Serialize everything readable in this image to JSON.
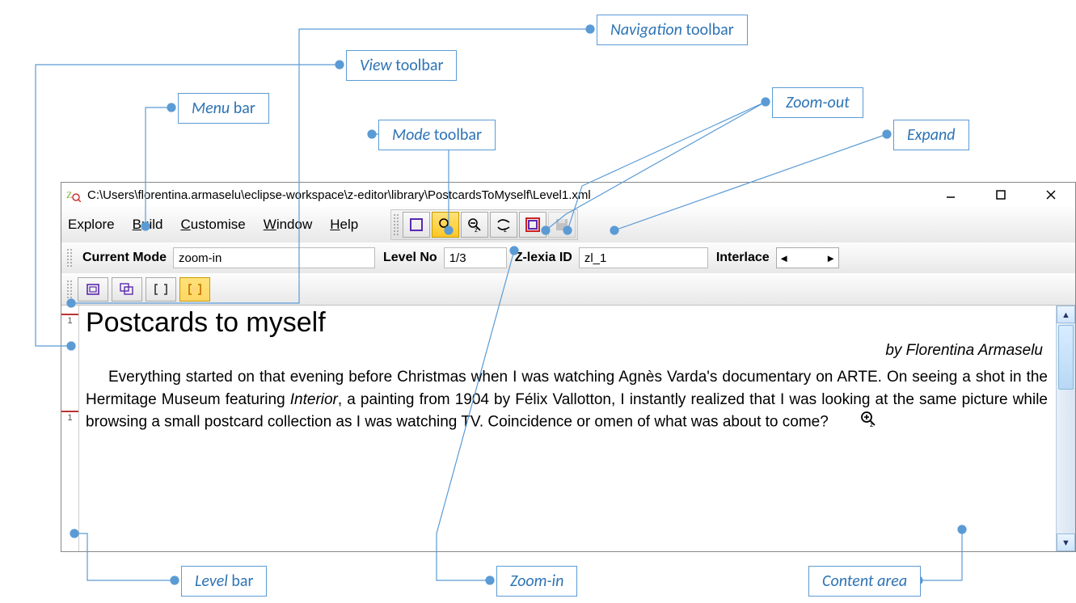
{
  "callouts": {
    "navigation_toolbar": "Navigation ",
    "navigation_toolbar_suffix": "toolbar",
    "view_toolbar": "View ",
    "view_toolbar_suffix": "toolbar",
    "menu_bar": "Menu ",
    "menu_bar_suffix": "bar",
    "mode_toolbar": "Mode ",
    "mode_toolbar_suffix": "toolbar",
    "zoom_out": "Zoom-out",
    "expand": "Expand",
    "zoom_in": "Zoom-in",
    "level_bar": "Level ",
    "level_bar_suffix": "bar",
    "content_area": "Content area"
  },
  "window": {
    "title": "C:\\Users\\florentina.armaselu\\eclipse-workspace\\z-editor\\library\\PostcardsToMyself\\Level1.xml"
  },
  "menu": {
    "explore": "Explore",
    "build": "Build",
    "customise": "Customise",
    "window": "Window",
    "help": "Help"
  },
  "nav": {
    "current_mode_label": "Current Mode",
    "current_mode_value": "zoom-in",
    "level_no_label": "Level No",
    "level_no_value": "1/3",
    "zlexia_label": "Z-lexia ID",
    "zlexia_value": "zl_1",
    "interlace_label": "Interlace",
    "interlace_value": ""
  },
  "level_marks": [
    "1",
    "1"
  ],
  "content": {
    "heading": "Postcards to myself",
    "byline": "by Florentina Armaselu",
    "para_part1": "Everything started on that evening before Christmas when I was watching Agnès Varda's documentary on ARTE. On seeing a shot in the Hermitage Museum featuring ",
    "para_italic": "Interior",
    "para_part2": ", a painting from 1904 by Félix Vallotton, I instantly realized that I was looking at the same picture while browsing a small postcard collection as I was watching TV. Coincidence or omen of what was about to come?"
  }
}
